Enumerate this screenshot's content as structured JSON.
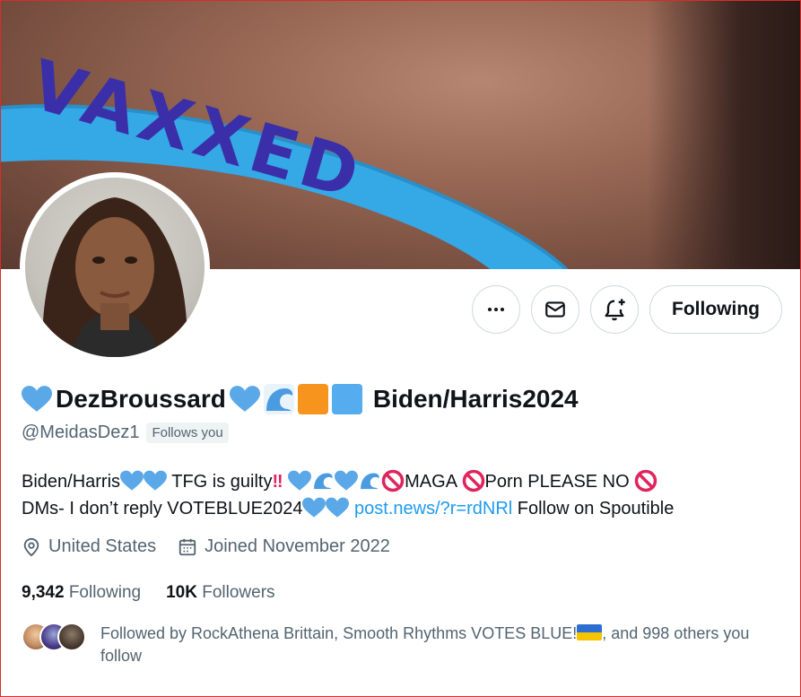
{
  "banner": {
    "band_text": "VAXXED"
  },
  "profile": {
    "display_name": "DezBroussard",
    "name_suffix": "Biden/Harris2024",
    "handle": "@MeidasDez1",
    "follows_you_badge": "Follows you"
  },
  "actions": {
    "more_icon": "more-icon",
    "message_icon": "envelope-icon",
    "notify_icon": "bell-plus-icon",
    "following_label": "Following"
  },
  "bio": {
    "part1": "Biden/Harris",
    "part2": " TFG is guilty",
    "part3": "MAGA ",
    "part4": "Porn PLEASE NO ",
    "part5": "DMs- I don’t reply VOTEBLUE2024",
    "link": "post.news/?r=rdNRl",
    "part6": " Follow on Spoutible"
  },
  "meta": {
    "location": "United States",
    "joined": "Joined November 2022"
  },
  "stats": {
    "following_count": "9,342",
    "following_label": "Following",
    "followers_count": "10K",
    "followers_label": "Followers"
  },
  "followed_by": {
    "text_before": "Followed by RockAthena Brittain, Smooth Rhythms VOTES BLUE!",
    "text_after": ", and 998 others you follow"
  },
  "colors": {
    "accent": "#1d9bf0",
    "heart_blue": "#5aa8e8",
    "orange_square": "#f7941d",
    "blue_square": "#55acee",
    "band_blue": "#35a8e6"
  }
}
